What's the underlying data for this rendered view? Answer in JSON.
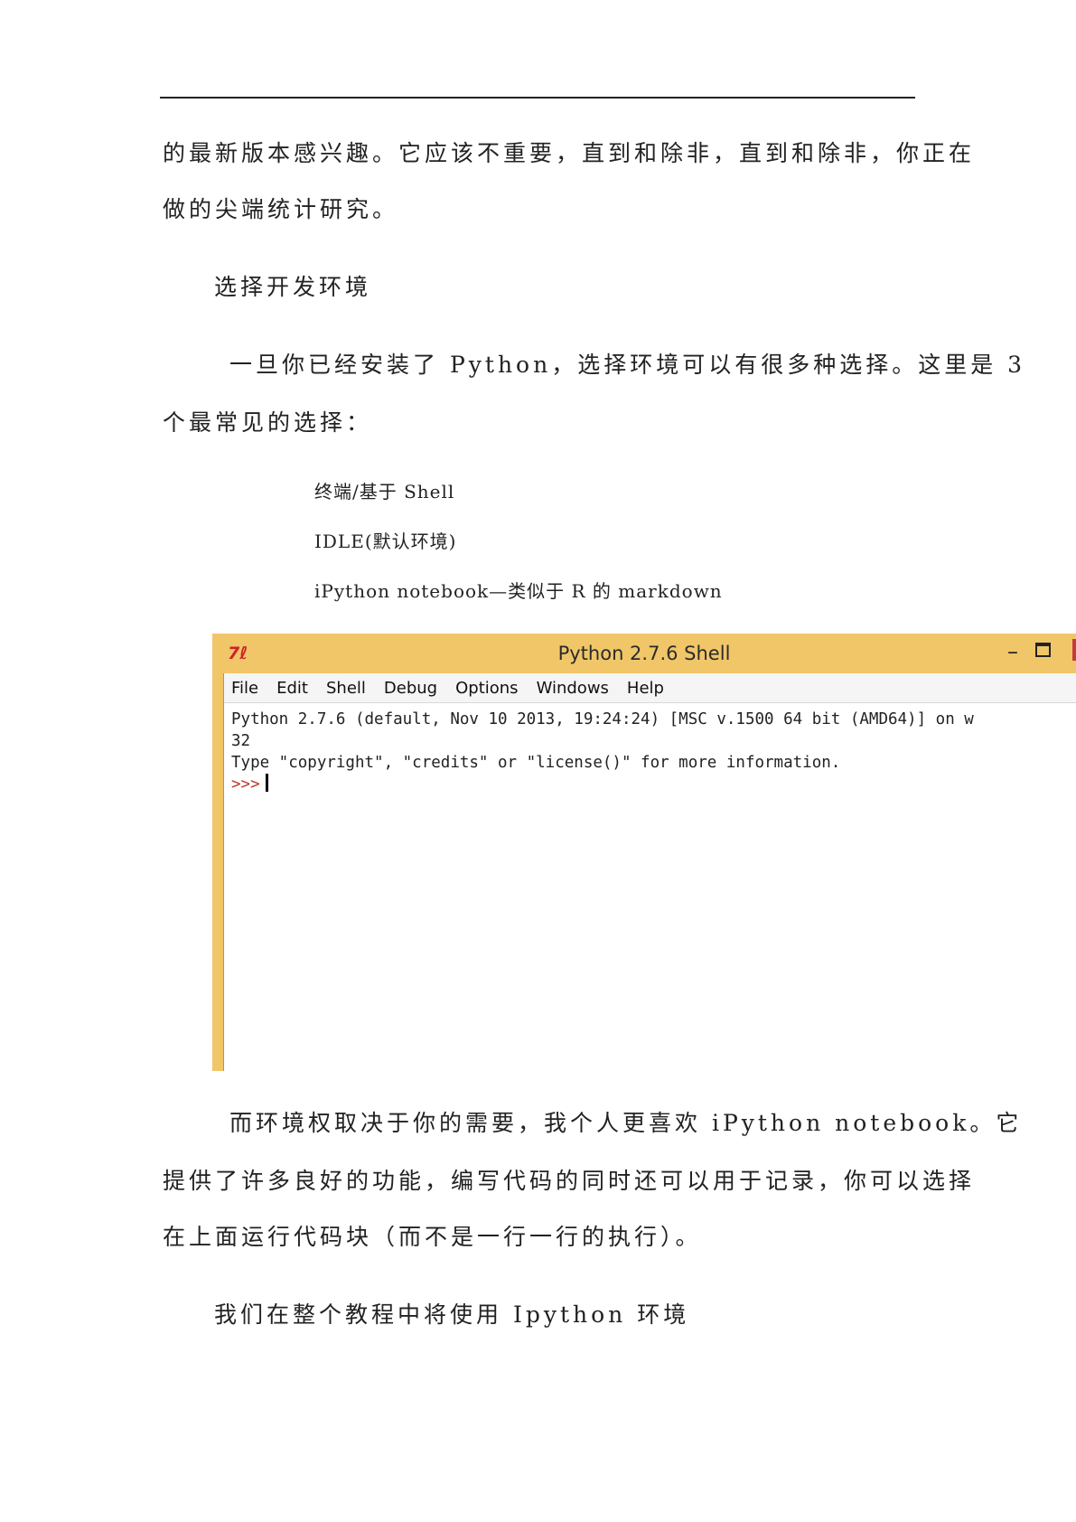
{
  "document": {
    "p1_line1": "的最新版本感兴趣。它应该不重要，直到和除非，直到和除非，你正在",
    "p1_line2": "做的尖端统计研究。",
    "heading": "选择开发环境",
    "p2_line1": "一旦你已经安装了 Python，选择环境可以有很多种选择。这里是 3",
    "p2_line2": "个最常见的选择：",
    "list": [
      "终端/基于 Shell",
      "IDLE(默认环境)",
      "iPython notebook—类似于 R 的 markdown"
    ],
    "p3_line1": "而环境权取决于你的需要，我个人更喜欢 iPython notebook。它",
    "p3_line2": "提供了许多良好的功能，编写代码的同时还可以用于记录，你可以选择",
    "p3_line3": "在上面运行代码块（而不是一行一行的执行）。",
    "p4": "我们在整个教程中将使用 Ipython 环境"
  },
  "shell": {
    "icon_text": "7ℓ",
    "title": "Python 2.7.6 Shell",
    "minimize": "–",
    "menu": [
      "File",
      "Edit",
      "Shell",
      "Debug",
      "Options",
      "Windows",
      "Help"
    ],
    "console_line1": "Python 2.7.6 (default, Nov 10 2013, 19:24:24) [MSC v.1500 64 bit (AMD64)] on w",
    "console_line2": "32",
    "console_line3": "Type \"copyright\", \"credits\" or \"license()\" for more information.",
    "prompt": ">>>"
  }
}
